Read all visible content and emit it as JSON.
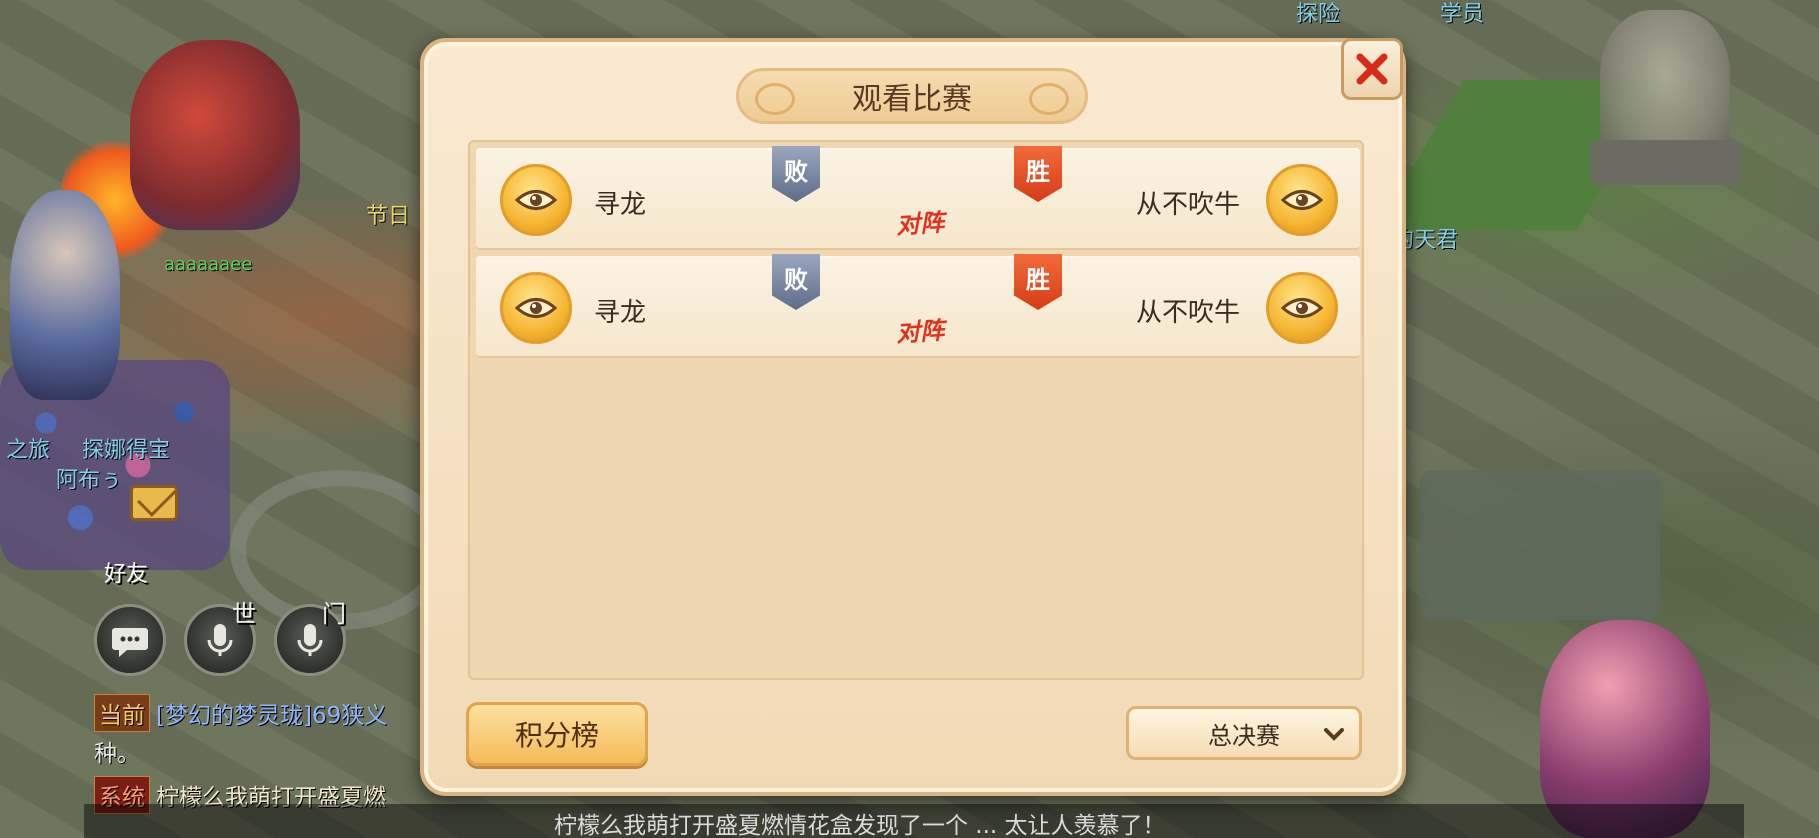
{
  "dialog": {
    "title": "观看比赛",
    "close_label": "✕",
    "vs_label": "对阵",
    "matches": [
      {
        "left_player": "寻龙",
        "left_result": "败",
        "right_player": "从不吹牛",
        "right_result": "胜"
      },
      {
        "left_player": "寻龙",
        "left_result": "败",
        "right_player": "从不吹牛",
        "right_result": "胜"
      }
    ],
    "score_button": "积分榜",
    "stage_select": {
      "selected": "总决赛"
    }
  },
  "hud": {
    "friends_label": "好友",
    "world_tag": "世",
    "faction_tag": "门"
  },
  "chat": {
    "line1_channel": "当前",
    "line1_text": "[梦幻的梦灵珑]69狭义",
    "line2_text": "种。",
    "line3_channel": "系统",
    "line3_text": "柠檬么我萌打开盛夏燃",
    "marquee": "柠檬么我萌打开盛夏燃情花盒发现了一个 ... 太让人羡慕了！"
  },
  "scene_tags": {
    "tag1": "节日",
    "tag2": "aaaaaaee",
    "tag3": "探险",
    "tag4": "学员",
    "tag5": "的天君",
    "tag6": "之旅",
    "tag7": "探娜得宝",
    "tag8": "阿布ぅ"
  },
  "colors": {
    "accent_win": "#d63c17",
    "accent_lose": "#5d6c88",
    "panel_bg": "#f1d9b5",
    "button_gold": "#f5bb5a"
  },
  "icons": [
    "close-icon",
    "eye-icon",
    "chat-bubble-icon",
    "microphone-icon",
    "mail-icon",
    "chevron-down-icon"
  ]
}
